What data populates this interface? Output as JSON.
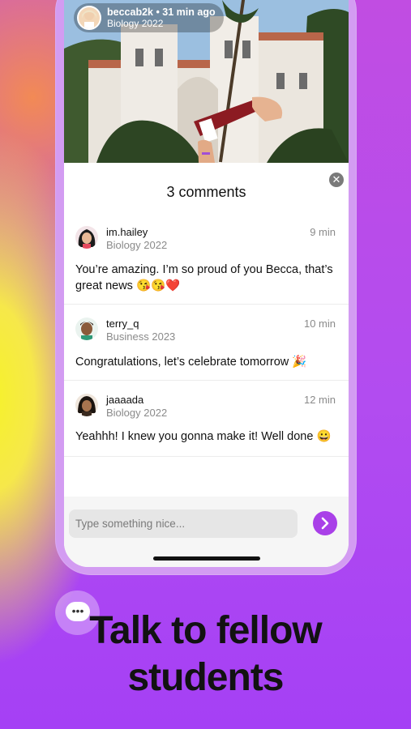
{
  "post": {
    "username_time": "beccab2k • 31 min ago",
    "program": "Biology 2022",
    "pennant_text": "SDSU"
  },
  "comments_sheet": {
    "title": "3 comments",
    "close_glyph": "✕"
  },
  "comments": [
    {
      "user": "im.hailey",
      "program": "Biology 2022",
      "time": "9 min",
      "text": "You’re amazing. I’m so proud of you Becca, that’s great news 😘😘❤️"
    },
    {
      "user": "terry_q",
      "program": "Business 2023",
      "time": "10 min",
      "text": "Congratulations, let’s celebrate tomorrow 🎉"
    },
    {
      "user": "jaaaada",
      "program": "Biology 2022",
      "time": "12 min",
      "text": "Yeahhh! I knew you gonna make it! Well done 😀"
    }
  ],
  "composer": {
    "placeholder": "Type something nice...",
    "send_icon": "arrow-right-icon"
  },
  "promo": {
    "headline_line1": "Talk to fellow",
    "headline_line2": "students",
    "bubble_icon": "chat-bubble-icon",
    "bubble_glyph": "•••"
  },
  "colors": {
    "accent": "#a940e8",
    "background": "#b24cf0"
  }
}
